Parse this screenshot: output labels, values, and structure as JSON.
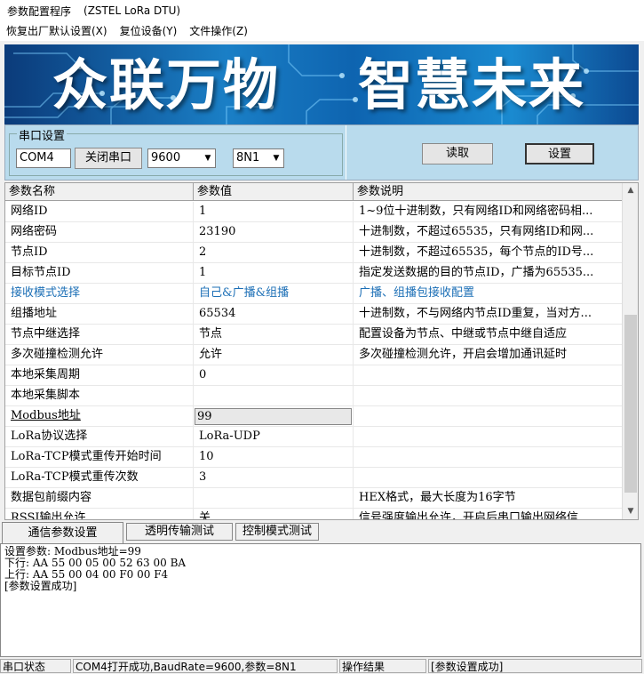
{
  "window": {
    "title": "参数配置程序",
    "subtitle": "(ZSTEL LoRa DTU)"
  },
  "menu": [
    "恢复出厂默认设置(X)",
    "复位设备(Y)",
    "文件操作(Z)"
  ],
  "banner": {
    "slogan_left": "众联万物",
    "slogan_right": "智慧未来"
  },
  "serial": {
    "group_label": "串口设置",
    "port_value": "COM4",
    "close_button": "关闭串口",
    "baud_value": "9600",
    "format_value": "8N1",
    "read_button": "读取",
    "set_button": "设置"
  },
  "grid": {
    "headers": [
      "参数名称",
      "参数值",
      "参数说明"
    ],
    "rows": [
      {
        "name": "网络ID",
        "value": "1",
        "desc": "1~9位十进制数，只有网络ID和网络密码相..."
      },
      {
        "name": "网络密码",
        "value": "23190",
        "desc": "十进制数，不超过65535，只有网络ID和网..."
      },
      {
        "name": "节点ID",
        "value": "2",
        "desc": "十进制数，不超过65535，每个节点的ID号..."
      },
      {
        "name": "目标节点ID",
        "value": "1",
        "desc": "指定发送数据的目的节点ID，广播为65535..."
      },
      {
        "name": "接收模式选择",
        "value": "自己&广播&组播",
        "desc": "广播、组播包接收配置"
      },
      {
        "name": "组播地址",
        "value": "65534",
        "desc": "十进制数，不与网络内节点ID重复，当对方..."
      },
      {
        "name": "节点中继选择",
        "value": "节点",
        "desc": "配置设备为节点、中继或节点中继自适应"
      },
      {
        "name": "多次碰撞检测允许",
        "value": "允许",
        "desc": "多次碰撞检测允许，开启会增加通讯延时"
      },
      {
        "name": "本地采集周期",
        "value": "0",
        "desc": ""
      },
      {
        "name": "本地采集脚本",
        "value": "",
        "desc": ""
      },
      {
        "name": "Modbus地址",
        "value": "99",
        "desc": ""
      },
      {
        "name": "LoRa协议选择",
        "value": "LoRa-UDP",
        "desc": ""
      },
      {
        "name": "LoRa-TCP模式重传开始时间",
        "value": "10",
        "desc": ""
      },
      {
        "name": "LoRa-TCP模式重传次数",
        "value": "3",
        "desc": ""
      },
      {
        "name": "数据包前缀内容",
        "value": "",
        "desc": "HEX格式，最大长度为16字节"
      },
      {
        "name": "RSSI输出允许",
        "value": "关",
        "desc": "信号强度输出允许，开启后串口输出网络信..."
      }
    ]
  },
  "tabs": [
    "通信参数设置",
    "透明传输测试",
    "控制模式测试"
  ],
  "log": "设置参数: Modbus地址=99\n下行: AA 55 00 05 00 52 63 00 BA\n上行: AA 55 00 04 00 F0 00 F4\n[参数设置成功]",
  "status": {
    "label1": "串口状态",
    "value1": "COM4打开成功,BaudRate=9600,参数=8N1",
    "label2": "操作结果",
    "value2": "[参数设置成功]"
  }
}
